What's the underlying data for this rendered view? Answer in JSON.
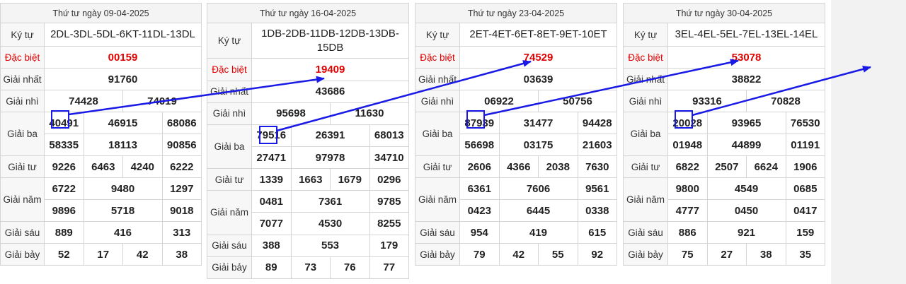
{
  "labels": {
    "ky_tu": "Ký tự",
    "dac_biet": "Đặc biệt",
    "giai_nhat": "Giải nhất",
    "giai_nhi": "Giải nhì",
    "giai_ba": "Giải ba",
    "giai_tu": "Giải tư",
    "giai_nam": "Giải năm",
    "giai_sau": "Giải sáu",
    "giai_bay": "Giải bảy"
  },
  "tables": [
    {
      "header": "Thứ tư ngày 09-04-2025",
      "ky_tu": "2DL-3DL-5DL-6KT-11DL-13DL",
      "dac_biet": "00159",
      "giai_nhat": "91760",
      "giai_nhi": [
        "74428",
        "74019"
      ],
      "giai_ba": [
        "40491",
        "46915",
        "68086",
        "58335",
        "18113",
        "90856"
      ],
      "giai_tu": [
        "9226",
        "6463",
        "4240",
        "6222"
      ],
      "giai_nam": [
        "6722",
        "9480",
        "1297",
        "9896",
        "5718",
        "9018"
      ],
      "giai_sau": [
        "889",
        "416",
        "313"
      ],
      "giai_bay": [
        "52",
        "17",
        "42",
        "38"
      ]
    },
    {
      "header": "Thứ tư ngày 16-04-2025",
      "ky_tu": "1DB-2DB-11DB-12DB-13DB-15DB",
      "dac_biet": "19409",
      "giai_nhat": "43686",
      "giai_nhi": [
        "95698",
        "11630"
      ],
      "giai_ba": [
        "79516",
        "26391",
        "68013",
        "27471",
        "97978",
        "34710"
      ],
      "giai_tu": [
        "1339",
        "1663",
        "1679",
        "0296"
      ],
      "giai_nam": [
        "0481",
        "7361",
        "9785",
        "7077",
        "4530",
        "8255"
      ],
      "giai_sau": [
        "388",
        "553",
        "179"
      ],
      "giai_bay": [
        "89",
        "73",
        "76",
        "77"
      ]
    },
    {
      "header": "Thứ tư ngày 23-04-2025",
      "ky_tu": "2ET-4ET-6ET-8ET-9ET-10ET",
      "dac_biet": "74529",
      "giai_nhat": "03639",
      "giai_nhi": [
        "06922",
        "50756"
      ],
      "giai_ba": [
        "87939",
        "31477",
        "94428",
        "56698",
        "03175",
        "21603"
      ],
      "giai_tu": [
        "2606",
        "4366",
        "2038",
        "7630"
      ],
      "giai_nam": [
        "6361",
        "7606",
        "9561",
        "0423",
        "6445",
        "0338"
      ],
      "giai_sau": [
        "954",
        "419",
        "615"
      ],
      "giai_bay": [
        "79",
        "42",
        "55",
        "92"
      ]
    },
    {
      "header": "Thứ tư ngày 30-04-2025",
      "ky_tu": "3EL-4EL-5EL-7EL-13EL-14EL",
      "dac_biet": "53078",
      "giai_nhat": "38822",
      "giai_nhi": [
        "93316",
        "70828"
      ],
      "giai_ba": [
        "20028",
        "93965",
        "76530",
        "01948",
        "44899",
        "01191"
      ],
      "giai_tu": [
        "6822",
        "2507",
        "6624",
        "1906"
      ],
      "giai_nam": [
        "9800",
        "4549",
        "0685",
        "4777",
        "0450",
        "0417"
      ],
      "giai_sau": [
        "886",
        "921",
        "159"
      ],
      "giai_bay": [
        "75",
        "27",
        "38",
        "35"
      ]
    }
  ],
  "colors": {
    "arrow": "#1a1ae6",
    "highlight_box": "#1a1ae6",
    "special_prize": "#e00000"
  }
}
